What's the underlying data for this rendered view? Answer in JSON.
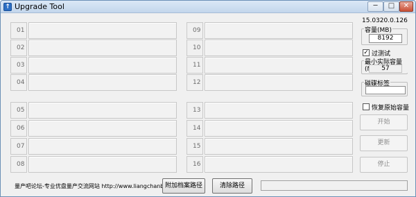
{
  "window": {
    "title": "Upgrade Tool",
    "controls": {
      "minimize": "─",
      "maximize": "□",
      "close": "✕"
    }
  },
  "ports": {
    "left": [
      "01",
      "02",
      "03",
      "04",
      "05",
      "06",
      "07",
      "08"
    ],
    "right": [
      "09",
      "10",
      "11",
      "12",
      "13",
      "14",
      "15",
      "16"
    ]
  },
  "side": {
    "version": "15.0320.0.126",
    "capacity": {
      "label": "容量(MB)",
      "value": "8192"
    },
    "over_test": {
      "label": "过测试",
      "checked": true
    },
    "min_capacity": {
      "label": "最小实际容量(MB)",
      "value": "57"
    },
    "disk_label": {
      "label": "磁碟标签",
      "value": ""
    },
    "restore_capacity": {
      "label": "恢复原始容量",
      "checked": false
    },
    "buttons": {
      "start": "开始",
      "update": "更新",
      "stop": "停止"
    }
  },
  "footer": {
    "site_text": "量产吧论坛-专业优盘量产交流网站 http://www.liangchanba.com/",
    "attach_path_button": "附加档案路径",
    "clear_path_button": "清除路径",
    "status": ""
  }
}
